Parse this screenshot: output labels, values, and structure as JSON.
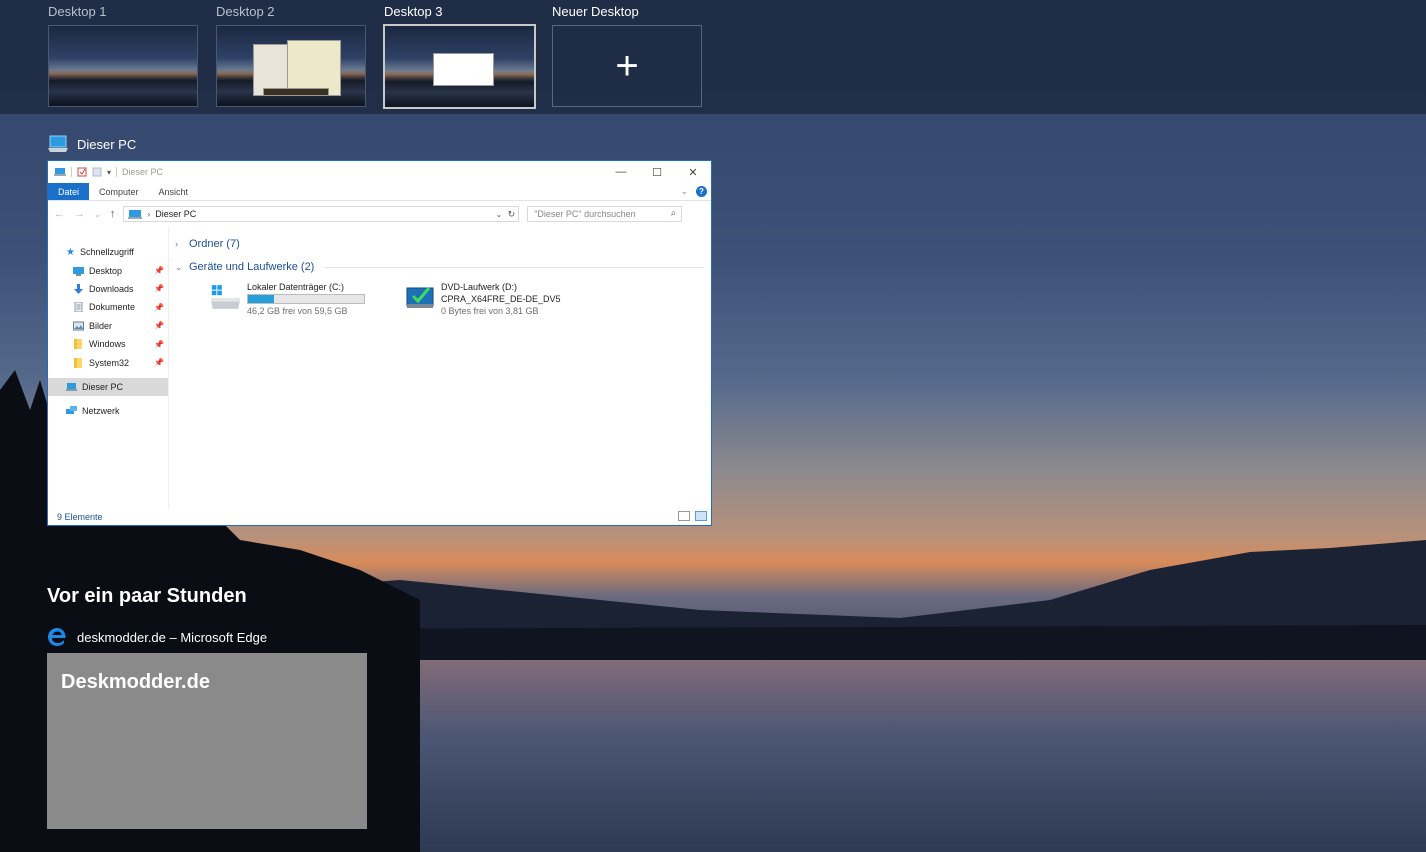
{
  "desktops": [
    {
      "label": "Desktop 1",
      "active": false
    },
    {
      "label": "Desktop 2",
      "active": false
    },
    {
      "label": "Desktop 3",
      "active": true
    }
  ],
  "new_desktop": {
    "label": "Neuer Desktop",
    "icon": "plus-icon",
    "glyph": "+"
  },
  "window": {
    "app_title": "Dieser PC",
    "titlebar_text": "Dieser PC",
    "ribbon_tabs": [
      "Datei",
      "Computer",
      "Ansicht"
    ],
    "address": "Dieser PC",
    "search_placeholder": "\"Dieser PC\" durchsuchen",
    "nav": {
      "quick_access": "Schnellzugriff",
      "items": [
        {
          "label": "Desktop",
          "icon": "desktop-icon"
        },
        {
          "label": "Downloads",
          "icon": "download-icon"
        },
        {
          "label": "Dokumente",
          "icon": "document-icon"
        },
        {
          "label": "Bilder",
          "icon": "pictures-icon"
        },
        {
          "label": "Windows",
          "icon": "folder-icon"
        },
        {
          "label": "System32",
          "icon": "folder-icon"
        }
      ],
      "this_pc": "Dieser PC",
      "network": "Netzwerk"
    },
    "groups": {
      "folders": "Ordner (7)",
      "devices": "Geräte und Laufwerke (2)"
    },
    "drives": [
      {
        "name": "Lokaler Datenträger (C:)",
        "free_text": "46,2 GB frei von 59,5 GB",
        "used_fraction": 0.224
      },
      {
        "name": "DVD-Laufwerk (D:)",
        "volume": "CPRA_X64FRE_DE-DE_DV5",
        "free_text": "0 Bytes frei von 3,81 GB"
      }
    ],
    "status": "9 Elemente"
  },
  "timeline": {
    "heading": "Vor ein paar Stunden",
    "activity_title": "deskmodder.de – Microsoft Edge",
    "card_text": "Deskmodder.de"
  },
  "colors": {
    "accent": "#1a6fc9",
    "edge_blue": "#1e88e5",
    "progress": "#26a0da"
  }
}
